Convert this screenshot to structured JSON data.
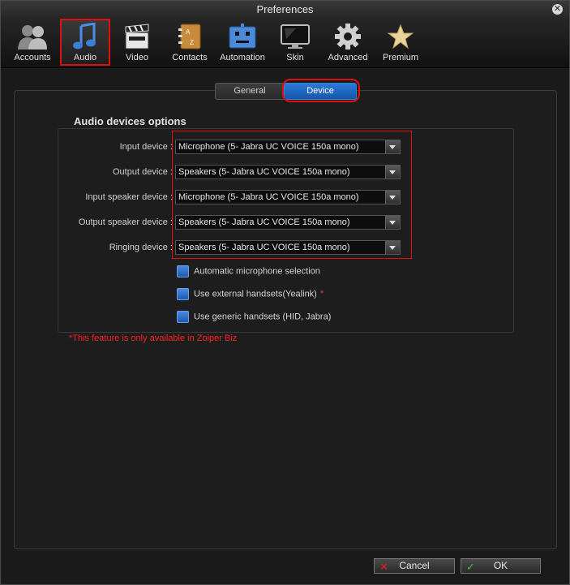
{
  "window": {
    "title": "Preferences"
  },
  "toolbar": {
    "items": [
      {
        "label": "Accounts",
        "icon": "users-icon"
      },
      {
        "label": "Audio",
        "icon": "music-note-icon",
        "active": true
      },
      {
        "label": "Video",
        "icon": "clapperboard-icon"
      },
      {
        "label": "Contacts",
        "icon": "address-book-icon"
      },
      {
        "label": "Automation",
        "icon": "robot-icon"
      },
      {
        "label": "Skin",
        "icon": "monitor-icon"
      },
      {
        "label": "Advanced",
        "icon": "gear-icon"
      },
      {
        "label": "Premium",
        "icon": "star-icon"
      }
    ]
  },
  "tabs": {
    "general": "General",
    "device": "Device",
    "active": "Device"
  },
  "audio": {
    "section_title": "Audio devices options",
    "devices": [
      {
        "label": "Input device :",
        "value": "Microphone (5- Jabra UC VOICE 150a mono)"
      },
      {
        "label": "Output device :",
        "value": "Speakers (5- Jabra UC VOICE 150a mono)"
      },
      {
        "label": "Input speaker device :",
        "value": "Microphone (5- Jabra UC VOICE 150a mono)"
      },
      {
        "label": "Output speaker device :",
        "value": "Speakers (5- Jabra UC VOICE 150a mono)"
      },
      {
        "label": "Ringing device :",
        "value": "Speakers (5- Jabra UC VOICE 150a mono)"
      }
    ],
    "options": [
      {
        "label": "Automatic microphone selection",
        "checked": false
      },
      {
        "label": "Use external handsets(Yealink)",
        "checked": false,
        "asterisk": "*"
      },
      {
        "label": "Use generic handsets (HID, Jabra)",
        "checked": false
      }
    ],
    "note": "*This feature is only available in Zoiper Biz"
  },
  "buttons": {
    "cancel": "Cancel",
    "ok": "OK"
  },
  "colors": {
    "accent": "#1f6ac8",
    "highlight": "#e01010",
    "note": "#ff2020"
  }
}
